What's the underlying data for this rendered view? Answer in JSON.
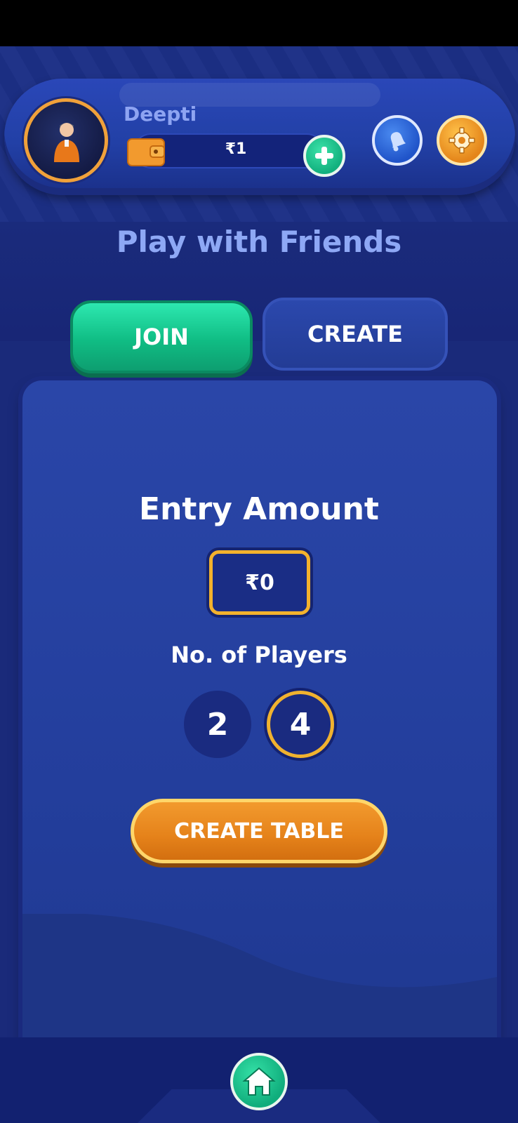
{
  "header": {
    "username": "Deepti",
    "balance": "₹1"
  },
  "page": {
    "title": "Play with Friends"
  },
  "tabs": {
    "join_label": "JOIN",
    "create_label": "CREATE",
    "active": "JOIN"
  },
  "create_form": {
    "entry_label": "Entry Amount",
    "entry_value": "₹0",
    "players_label": "No. of Players",
    "player_options": [
      "2",
      "4"
    ],
    "selected_players": "4",
    "create_button_label": "CREATE TABLE"
  },
  "icons": {
    "wallet": "wallet-icon",
    "add": "plus-icon",
    "notifications": "bell-icon",
    "settings": "gear-icon",
    "home": "home-icon"
  },
  "colors": {
    "background": "#1a2a7a",
    "accent_green": "#10bd84",
    "accent_orange": "#e5821a",
    "highlight_gold": "#f3b22d"
  }
}
